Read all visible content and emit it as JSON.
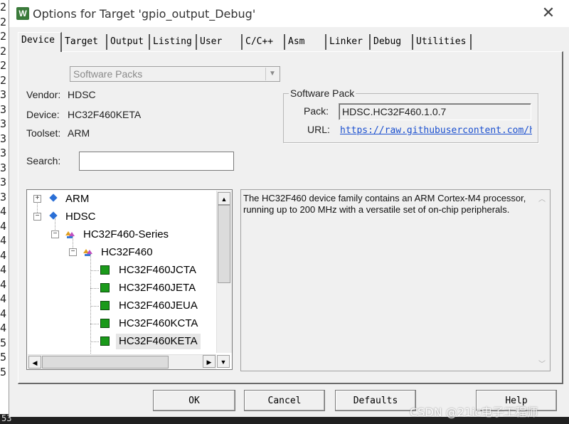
{
  "window": {
    "title": "Options for Target 'gpio_output_Debug'",
    "app_icon_letter": "W",
    "close_glyph": "✕"
  },
  "gutter_digits": [
    "2",
    "2",
    "2",
    "2",
    "2",
    "2",
    "3",
    "3",
    "3",
    "3",
    "3",
    "3",
    "3",
    "3",
    "4",
    "4",
    "4",
    "4",
    "4",
    "4",
    "4",
    "4",
    "4",
    "5",
    "5",
    "5"
  ],
  "gutter_bottom_text": "53",
  "tabs": [
    {
      "label": "Device",
      "active": true
    },
    {
      "label": "Target",
      "active": false
    },
    {
      "label": "Output",
      "active": false
    },
    {
      "label": "Listing",
      "active": false
    },
    {
      "label": "User",
      "active": false
    },
    {
      "label": "C/C++",
      "active": false
    },
    {
      "label": "Asm",
      "active": false
    },
    {
      "label": "Linker",
      "active": false
    },
    {
      "label": "Debug",
      "active": false
    },
    {
      "label": "Utilities",
      "active": false
    }
  ],
  "device": {
    "pack_select_value": "Software Packs",
    "vendor_label": "Vendor:",
    "vendor_value": "HDSC",
    "device_label": "Device:",
    "device_value": "HC32F460KETA",
    "toolset_label": "Toolset:",
    "toolset_value": "ARM",
    "search_label": "Search:",
    "search_value": ""
  },
  "software_pack": {
    "group_title": "Software Pack",
    "pack_label": "Pack:",
    "pack_value": "HDSC.HC32F460.1.0.7",
    "url_label": "URL:",
    "url_value": "https://raw.githubusercontent.com/hd"
  },
  "tree": {
    "items": [
      {
        "label": "ARM",
        "expander": "+"
      },
      {
        "label": "HDSC",
        "expander": "−"
      },
      {
        "label": "HC32F460-Series",
        "expander": "−"
      },
      {
        "label": "HC32F460",
        "expander": "−"
      },
      {
        "label": "HC32F460JCTA"
      },
      {
        "label": "HC32F460JETA"
      },
      {
        "label": "HC32F460JEUA"
      },
      {
        "label": "HC32F460KCTA"
      },
      {
        "label": "HC32F460KETA",
        "selected": true
      }
    ]
  },
  "description": {
    "text": "The HC32F460 device family contains an ARM Cortex-M4 processor, running up to 200 MHz with a versatile set of on-chip peripherals."
  },
  "buttons": {
    "ok": "OK",
    "cancel": "Cancel",
    "defaults": "Defaults",
    "help": "Help"
  },
  "watermark": "CSDN @21ic电子工程师",
  "colors": {
    "dialog_bg": "#f0f0f0",
    "link": "#1a4fcf",
    "chip_icon": "#1a9a1a",
    "diamond_icon": "#2a6fd6"
  }
}
